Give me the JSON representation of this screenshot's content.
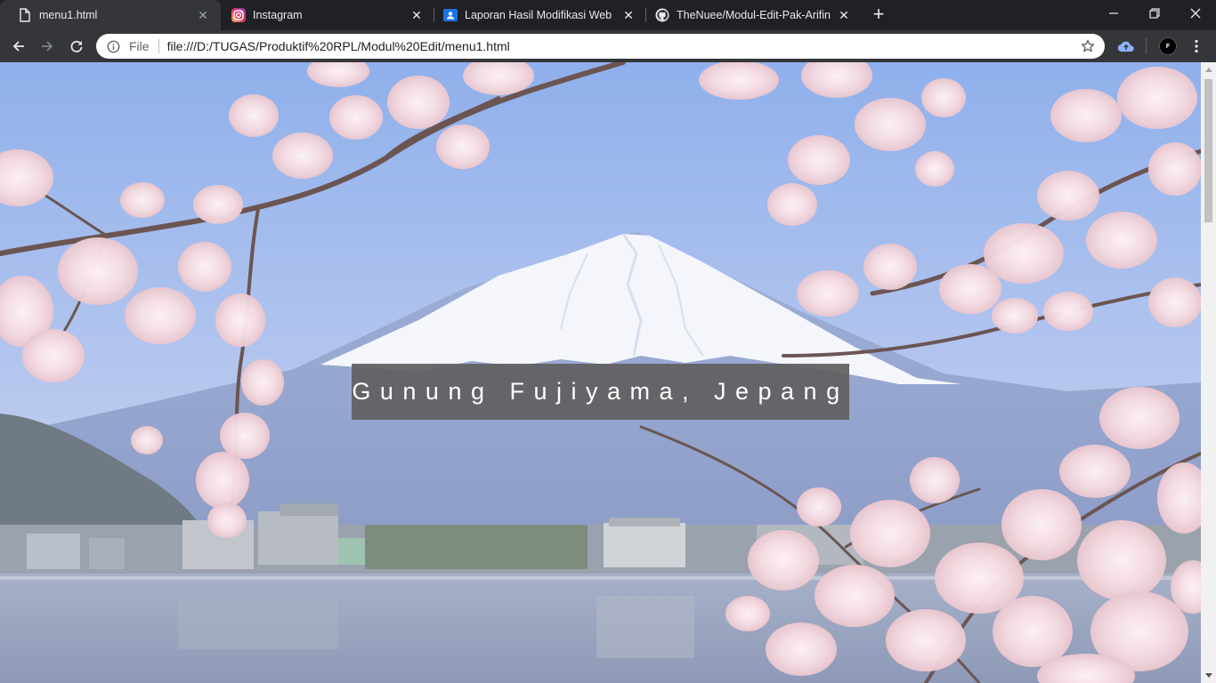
{
  "browser": {
    "tabs": [
      {
        "title": "menu1.html",
        "icon": "file-icon",
        "active": true
      },
      {
        "title": "Instagram",
        "icon": "instagram-icon",
        "active": false
      },
      {
        "title": "Laporan Hasil Modifikasi Web",
        "icon": "google-sites-icon",
        "active": false
      },
      {
        "title": "TheNuee/Modul-Edit-Pak-Arifin",
        "icon": "github-icon",
        "active": false
      }
    ],
    "new_tab_label": "+",
    "address_bar": {
      "security_chip": "File",
      "url": "file:///D:/TUGAS/Produktif%20RPL/Modul%20Edit/menu1.html"
    },
    "profile_initial": "F",
    "colors": {
      "tabstrip": "#202124",
      "toolbar": "#35363a",
      "instagram_accent": "#d6249f",
      "sites_accent": "#1a73e8"
    }
  },
  "page": {
    "banner_text": "Gunung Fujiyama, Jepang",
    "background": "Mount Fuji with cherry blossoms over lake",
    "scroll_position_fraction": 0.0
  }
}
